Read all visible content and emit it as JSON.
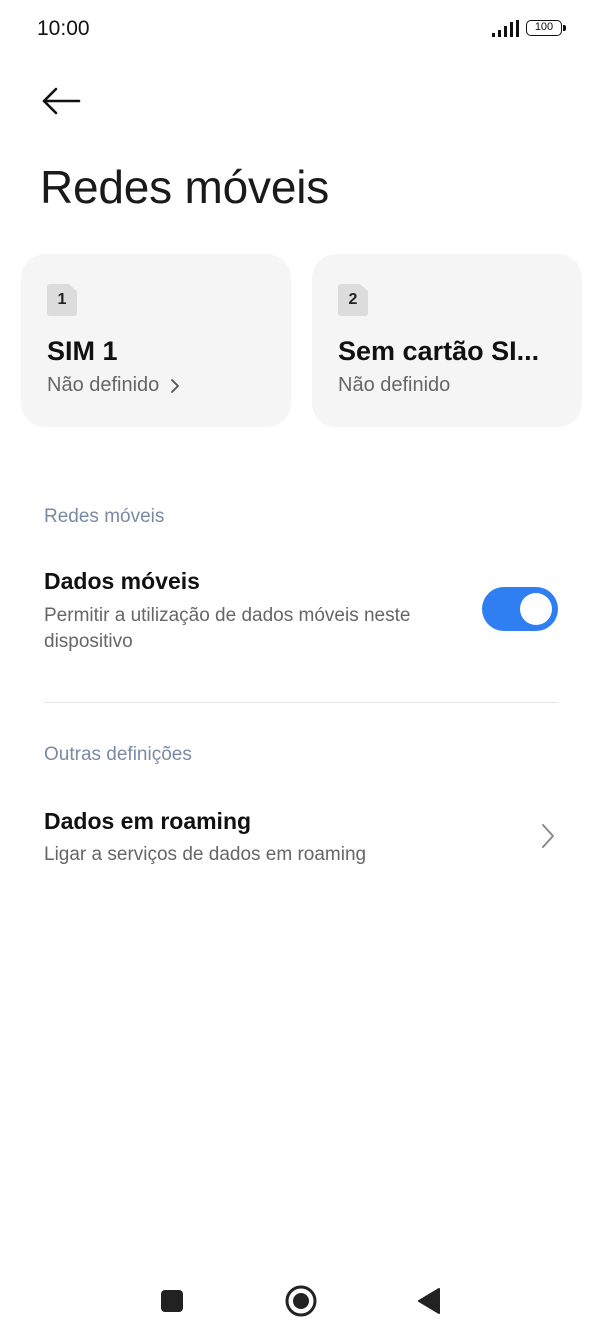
{
  "status_bar": {
    "time": "10:00",
    "battery": "100"
  },
  "header": {
    "title": "Redes móveis"
  },
  "sim_cards": [
    {
      "badge": "1",
      "name": "SIM 1",
      "status": "Não definido"
    },
    {
      "badge": "2",
      "name": "Sem cartão SI...",
      "status": "Não definido"
    }
  ],
  "sections": {
    "mobile_networks": {
      "header": "Redes móveis",
      "mobile_data": {
        "title": "Dados móveis",
        "subtitle": "Permitir a utilização de dados móveis neste dispositivo",
        "enabled": true
      }
    },
    "other_settings": {
      "header": "Outras definições",
      "roaming": {
        "title": "Dados em roaming",
        "subtitle": "Ligar a serviços de dados em roaming"
      }
    }
  },
  "colors": {
    "accent": "#2f7ff3",
    "section_header": "#7a8aa3",
    "card_bg": "#f5f5f5"
  },
  "icons": {
    "back": "arrow-left-icon",
    "signal": "signal-icon",
    "battery": "battery-icon",
    "chevron": "chevron-right-icon",
    "nav_recents": "square-icon",
    "nav_home": "circle-icon",
    "nav_back": "triangle-back-icon"
  }
}
